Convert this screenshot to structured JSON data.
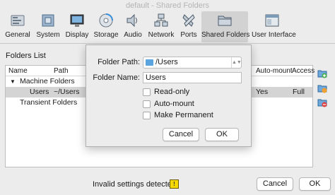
{
  "window": {
    "title": "default - Shared Folders"
  },
  "toolbar": {
    "items": [
      {
        "label": "General",
        "icon": "general-icon"
      },
      {
        "label": "System",
        "icon": "system-icon"
      },
      {
        "label": "Display",
        "icon": "display-icon"
      },
      {
        "label": "Storage",
        "icon": "storage-icon"
      },
      {
        "label": "Audio",
        "icon": "audio-icon"
      },
      {
        "label": "Network",
        "icon": "network-icon"
      },
      {
        "label": "Ports",
        "icon": "ports-icon"
      },
      {
        "label": "Shared Folders",
        "icon": "shared-folders-icon",
        "active": true
      },
      {
        "label": "User Interface",
        "icon": "user-interface-icon"
      }
    ]
  },
  "folders": {
    "section_label": "Folders List",
    "columns": {
      "name": "Name",
      "path": "Path",
      "auto_mount": "Auto-mount",
      "access": "Access"
    },
    "groups": [
      {
        "label": "Machine Folders"
      },
      {
        "label": "Transient Folders"
      }
    ],
    "rows": [
      {
        "name": "Users",
        "path": "~/Users",
        "auto_mount": "Yes",
        "access": "Full"
      }
    ]
  },
  "dialog": {
    "folder_path_label": "Folder Path:",
    "folder_path_value": "/Users",
    "folder_name_label": "Folder Name:",
    "folder_name_value": "Users",
    "read_only_label": "Read-only",
    "auto_mount_label": "Auto-mount",
    "make_permanent_label": "Make Permanent",
    "cancel_label": "Cancel",
    "ok_label": "OK"
  },
  "footer": {
    "status": "Invalid settings detected",
    "cancel_label": "Cancel",
    "ok_label": "OK"
  },
  "colors": {
    "selection": "#d4d4d4",
    "folder_blue": "#5aa4df",
    "warning": "#f5d800"
  }
}
